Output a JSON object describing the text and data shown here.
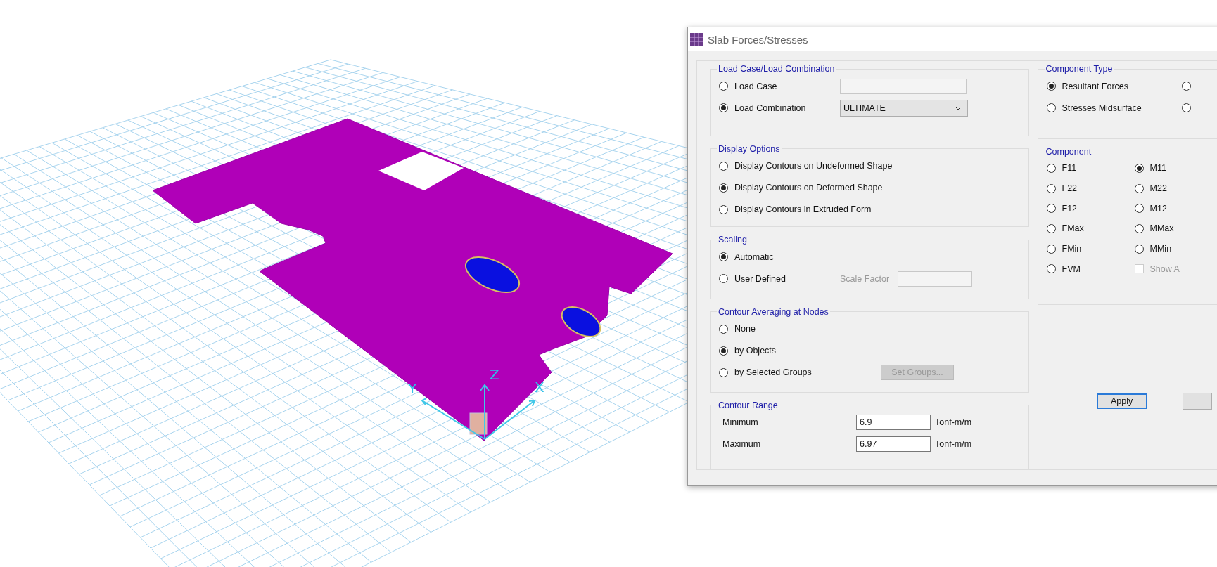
{
  "viewport": {
    "z_axis": "Z",
    "y_axis": "Y",
    "x_axis": "X"
  },
  "dialog": {
    "title": "Slab Forces/Stresses",
    "load_case_group": {
      "title": "Load Case/Load Combination",
      "options": [
        {
          "label": "Load Case",
          "selected": false
        },
        {
          "label": "Load Combination",
          "selected": true
        }
      ],
      "load_combination": "ULTIMATE"
    },
    "display_options": {
      "title": "Display Options",
      "options": [
        {
          "label": "Display Contours on Undeformed Shape",
          "selected": false
        },
        {
          "label": "Display Contours on Deformed Shape",
          "selected": true
        },
        {
          "label": "Display Contours in Extruded Form",
          "selected": false
        }
      ]
    },
    "scaling": {
      "title": "Scaling",
      "options": [
        {
          "label": "Automatic",
          "selected": true
        },
        {
          "label": "User Defined",
          "selected": false
        }
      ],
      "scale_factor_label": "Scale Factor"
    },
    "contour_averaging": {
      "title": "Contour Averaging at Nodes",
      "options": [
        {
          "label": "None",
          "selected": false
        },
        {
          "label": "by Objects",
          "selected": true
        },
        {
          "label": "by Selected Groups",
          "selected": false
        }
      ],
      "set_groups_button": "Set Groups..."
    },
    "contour_range": {
      "title": "Contour Range",
      "rows": [
        {
          "label": "Minimum",
          "value": "6.9",
          "unit": "Tonf-m/m"
        },
        {
          "label": "Maximum",
          "value": "6.97",
          "unit": "Tonf-m/m"
        }
      ]
    },
    "component_type": {
      "title": "Component Type",
      "options": [
        {
          "label": "Resultant Forces",
          "selected": true
        },
        {
          "selected": false
        },
        {
          "label": "Stresses Midsurface",
          "selected": false
        },
        {
          "selected": false
        }
      ]
    },
    "component": {
      "title": "Component",
      "options": [
        {
          "label": "F11",
          "selected": false
        },
        {
          "label": "M11",
          "selected": true
        },
        {
          "label": "F22",
          "selected": false
        },
        {
          "label": "M22",
          "selected": false
        },
        {
          "label": "F12",
          "selected": false
        },
        {
          "label": "M12",
          "selected": false
        },
        {
          "label": "FMax",
          "selected": false
        },
        {
          "label": "MMax",
          "selected": false
        },
        {
          "label": "FMin",
          "selected": false
        },
        {
          "label": "MMin",
          "selected": false
        },
        {
          "label": "FVM",
          "selected": false
        }
      ],
      "show_checkbox": {
        "label": "Show A",
        "checked": false,
        "disabled": true
      }
    },
    "apply_button": "Apply"
  }
}
